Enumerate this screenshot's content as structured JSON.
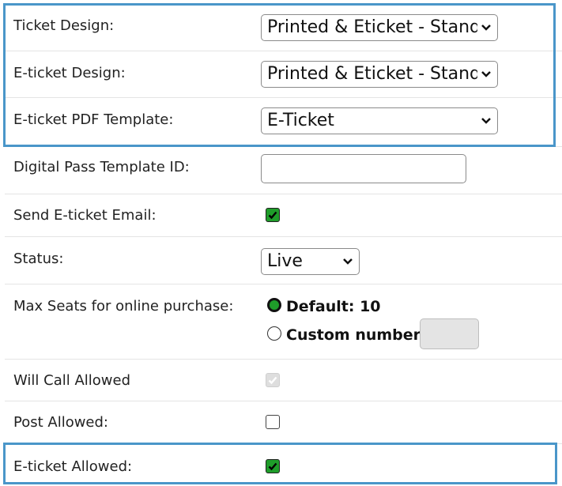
{
  "fields": {
    "ticket_design": {
      "label": "Ticket Design:",
      "value": "Printed & Eticket - Standard"
    },
    "eticket_design": {
      "label": "E-ticket Design:",
      "value": "Printed & Eticket - Standard"
    },
    "eticket_pdf_template": {
      "label": "E-ticket PDF Template:",
      "value": "E-Ticket"
    },
    "digital_pass_template_id": {
      "label": "Digital Pass Template ID:",
      "value": ""
    },
    "send_eticket_email": {
      "label": "Send E-ticket Email:",
      "checked": true
    },
    "status": {
      "label": "Status:",
      "value": "Live"
    },
    "max_seats": {
      "label": "Max Seats for online purchase:",
      "default_option": "Default: 10",
      "custom_option": "Custom number:",
      "selected": "default",
      "custom_value": ""
    },
    "will_call_allowed": {
      "label": "Will Call Allowed",
      "checked": true,
      "disabled": true
    },
    "post_allowed": {
      "label": "Post Allowed:",
      "checked": false
    },
    "eticket_allowed": {
      "label": "E-ticket Allowed:",
      "checked": true
    }
  },
  "colors": {
    "highlight_border": "#4a96c9",
    "checkbox_checked": "#1f9d2a",
    "row_divider": "#e4e4e4"
  },
  "icons": {
    "dropdown": "chevron-down-icon",
    "check": "check-icon"
  }
}
